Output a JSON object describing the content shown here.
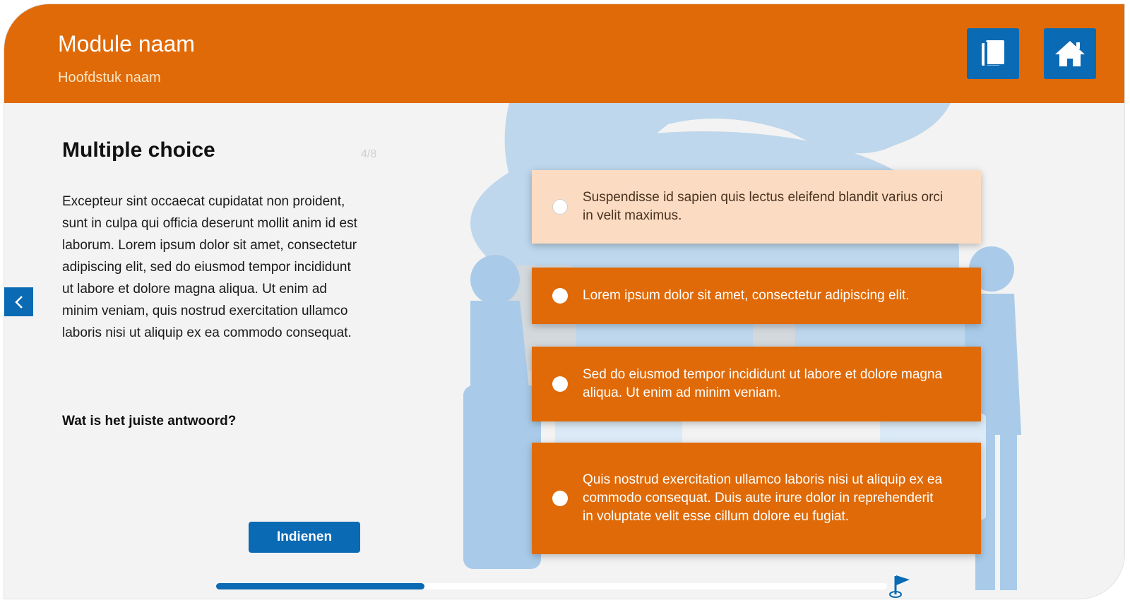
{
  "header": {
    "module_title": "Module naam",
    "chapter_title": "Hoofdstuk naam",
    "book_button_icon": "book-icon",
    "home_button_icon": "home-icon"
  },
  "content": {
    "title": "Multiple choice",
    "counter": "4/8",
    "body": "Excepteur sint occaecat cupidatat non proident, sunt in culpa qui officia deserunt mollit anim id est laborum. Lorem ipsum dolor sit amet, consectetur adipiscing elit, sed do eiusmod tempor incididunt ut labore et dolore magna aliqua. Ut enim ad minim veniam, quis nostrud exercitation ullamco laboris nisi ut aliquip ex ea commodo consequat.",
    "question": "Wat is het juiste antwoord?",
    "submit_label": "Indienen"
  },
  "options": [
    {
      "label": "Suspendisse id sapien quis lectus eleifend blandit varius orci in velit maximus.",
      "selected": true
    },
    {
      "label": "Lorem ipsum dolor sit amet, consectetur adipiscing elit.",
      "selected": false
    },
    {
      "label": "Sed do eiusmod tempor incididunt ut labore et dolore magna aliqua. Ut enim ad minim veniam.",
      "selected": false
    },
    {
      "label": "Quis nostrud exercitation ullamco laboris nisi ut aliquip ex ea commodo consequat. Duis aute irure dolor in reprehenderit in voluptate velit esse cillum dolore eu fugiat.",
      "selected": false
    }
  ],
  "navigation": {
    "prev_icon": "chevron-left-icon",
    "progress": 0.31,
    "finish_icon": "flag-icon"
  },
  "colors": {
    "brand_orange": "#e06a07",
    "brand_blue": "#0a6ab4",
    "selected_option": "#fbdcc2",
    "background": "#f3f3f3"
  }
}
